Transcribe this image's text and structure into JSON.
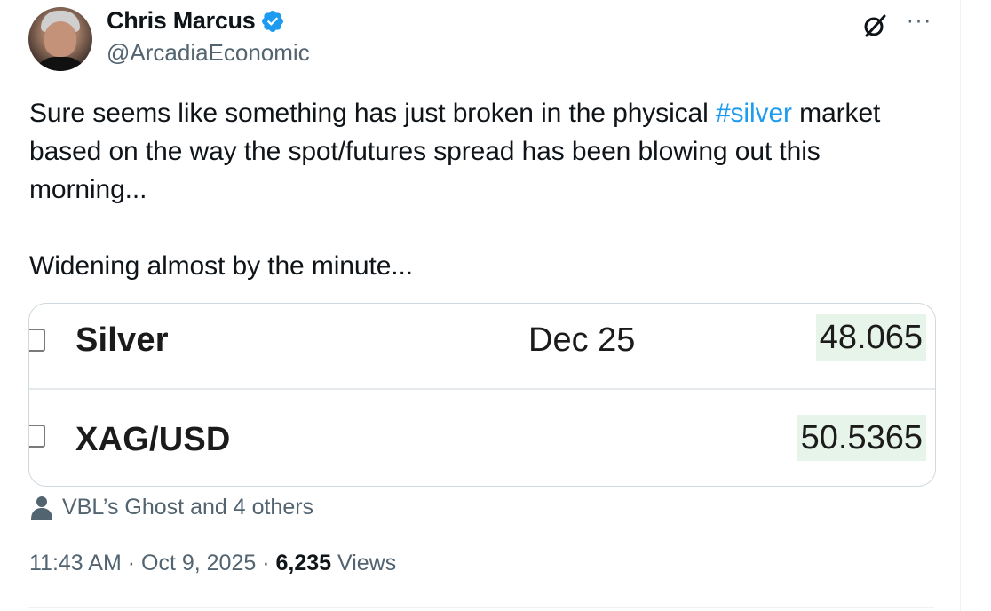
{
  "author": {
    "display_name": "Chris Marcus",
    "handle": "@ArcadiaEconomic",
    "verified": true,
    "verified_color": "#1d9bf0"
  },
  "header_icons": {
    "grok": "grok-icon",
    "more": "···"
  },
  "tweet": {
    "text_before": "Sure seems like something has just broken in the physical ",
    "hashtag": "#silver",
    "text_after": " market based on the way the spot/futures spread has been blowing out this morning...",
    "paragraph2": "Widening almost by the minute..."
  },
  "media": {
    "rows": [
      {
        "symbol": "Silver",
        "expiry": "Dec 25",
        "price": "48.065"
      },
      {
        "symbol": "XAG/USD",
        "expiry": "",
        "price": "50.5365"
      }
    ],
    "price_highlight_color": "#e6f4ea"
  },
  "tagged": {
    "icon": "person-icon",
    "text": "VBL’s Ghost and 4 others"
  },
  "meta": {
    "time": "11:43 AM",
    "separator": " · ",
    "date": "Oct 9, 2025",
    "views_count": "6,235",
    "views_label": " Views"
  },
  "colors": {
    "link": "#1d9bf0",
    "secondary_text": "#536471",
    "primary_text": "#0f1419"
  }
}
